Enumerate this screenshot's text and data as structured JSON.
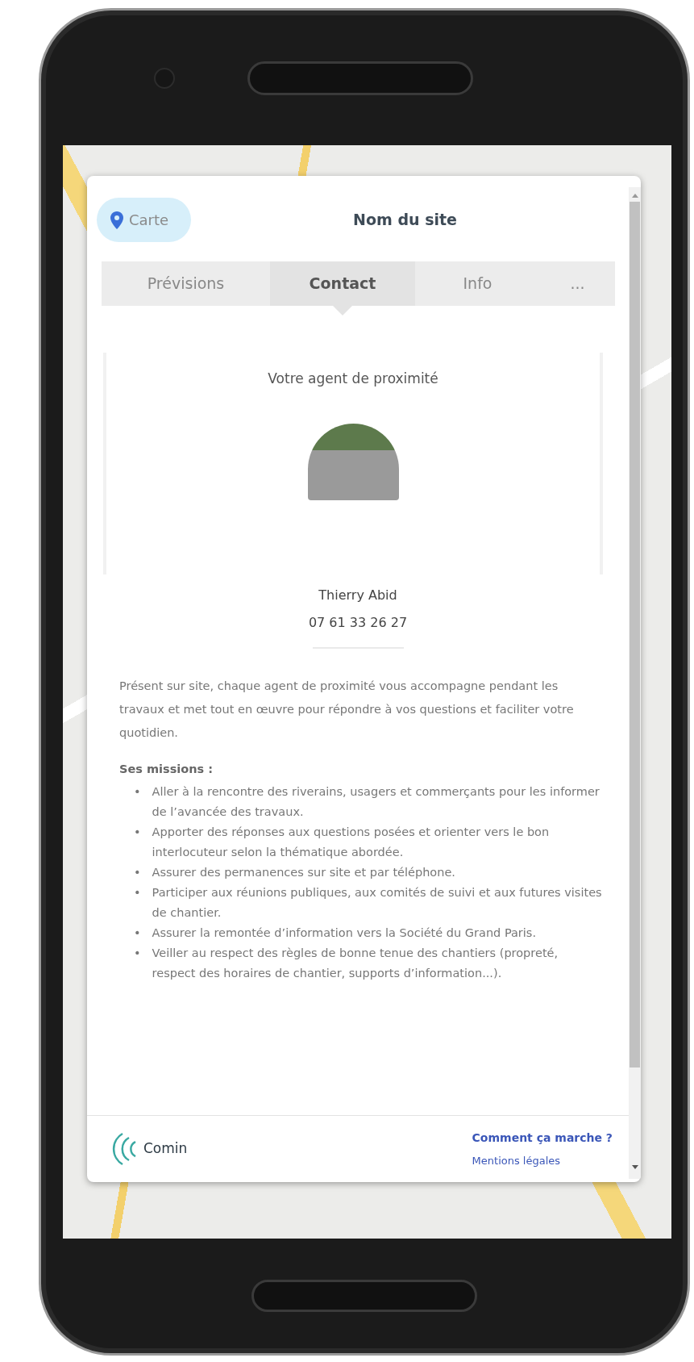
{
  "header": {
    "map_button": "Carte",
    "title": "Nom du site"
  },
  "tabs": [
    {
      "label": "Prévisions",
      "selected": false
    },
    {
      "label": "Contact",
      "selected": true
    },
    {
      "label": "Info",
      "selected": false
    },
    {
      "label": "...",
      "selected": false
    }
  ],
  "contact": {
    "heading": "Votre agent de proximité",
    "name": "Thierry Abid",
    "phone": "07 61 33 26 27"
  },
  "description": "Présent sur site, chaque agent de proximité vous accompagne pendant les travaux et met tout en œuvre pour répondre à vos questions et faciliter votre quotidien.",
  "missions": {
    "heading": "Ses missions :",
    "bullet": "•",
    "items": [
      "Aller à la rencontre des riverains, usagers et commerçants pour les informer de l’avancée des travaux.",
      "Apporter des réponses aux questions posées et orienter vers le bon interlocuteur selon la thématique abordée.",
      "Assurer des permanences sur site et par téléphone.",
      "Participer aux réunions publiques, aux comités de suivi et aux futures visites de chantier.",
      "Assurer la remontée d’information vers la Société du Grand Paris.",
      "Veiller au respect des règles de bonne tenue des chantiers (propreté, respect des horaires de chantier, supports d’information...)."
    ]
  },
  "footer": {
    "logo": "Comin",
    "links": [
      {
        "label": "Comment ça marche ?",
        "kind": "primary"
      },
      {
        "label": "Mentions légales",
        "kind": "secondary"
      }
    ]
  }
}
